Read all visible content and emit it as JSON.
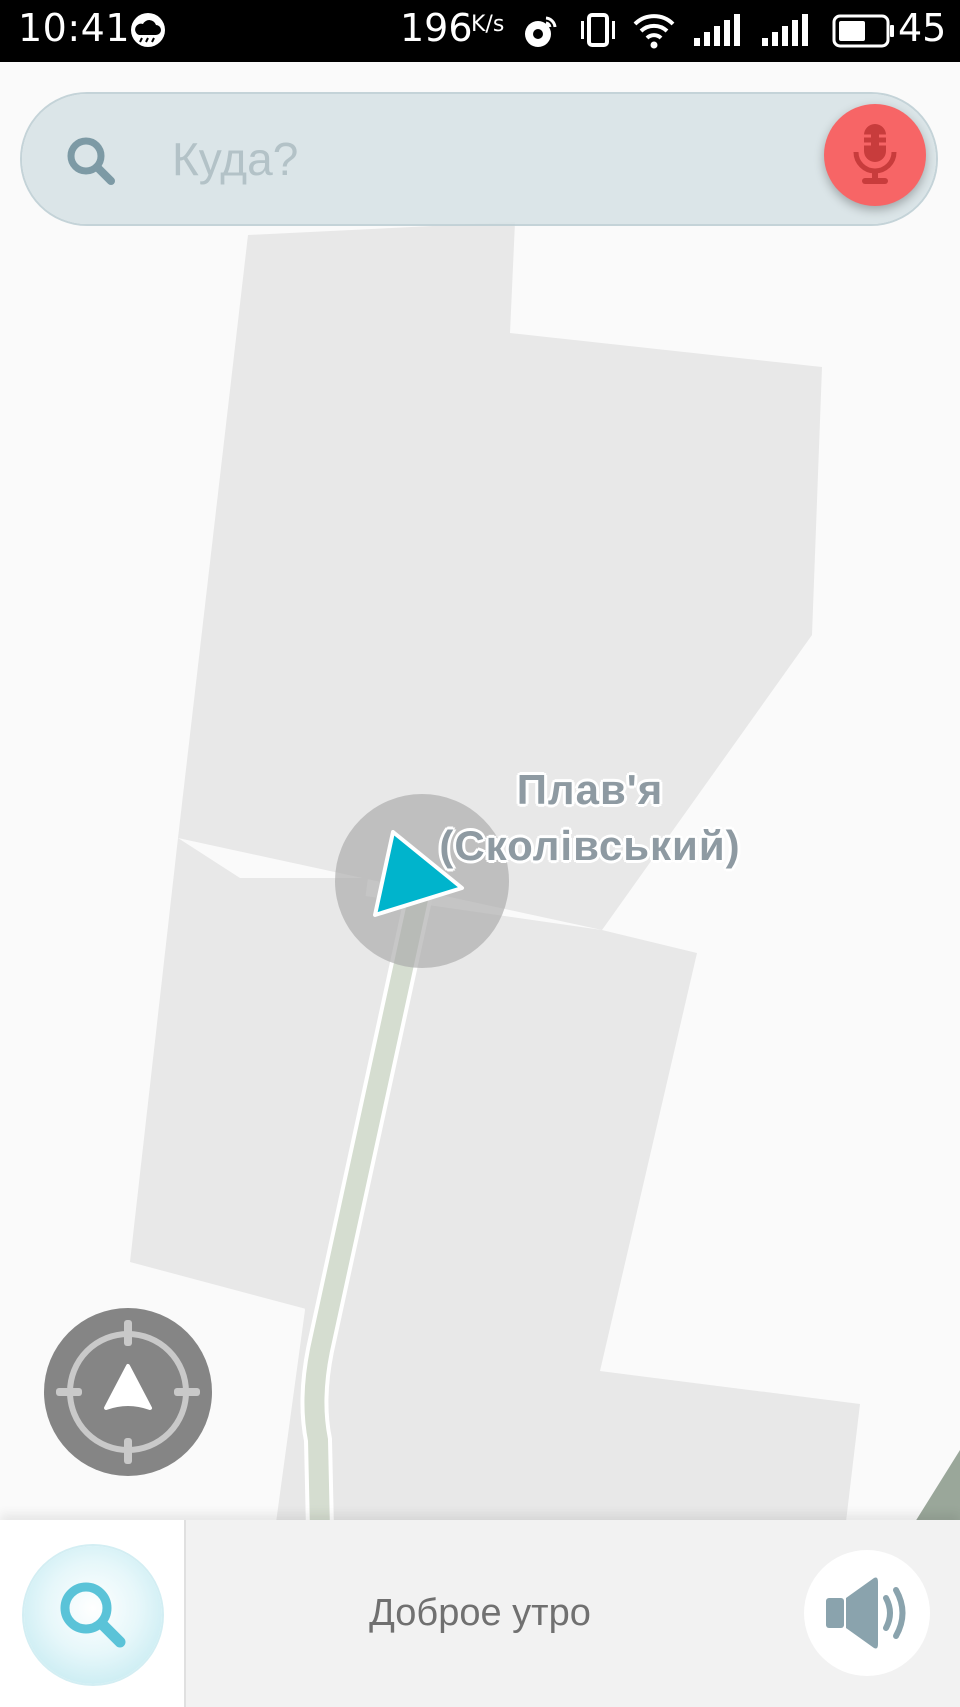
{
  "status_bar": {
    "time": "10:41",
    "network_speed": "196",
    "network_speed_unit": "K/s",
    "battery_level": "45",
    "icons": [
      "weather-cloud-icon",
      "location-sync-icon",
      "vibrate-icon",
      "wifi-icon",
      "signal-icon",
      "signal-icon",
      "battery-icon"
    ]
  },
  "search": {
    "placeholder": "Куда?",
    "icon": "search-icon",
    "voice_icon": "microphone-icon"
  },
  "map": {
    "place_label_line1": "Плав'я",
    "place_label_line2": "(Сколівський)",
    "position_marker_icon": "navigation-arrow-icon",
    "colors": {
      "background": "#fafafa",
      "area": "#e8e8e8",
      "road": "#d5ddd0",
      "marker": "#00b4cc",
      "marker_halo": "#a9a9a9"
    }
  },
  "controls": {
    "recenter_icon": "compass-target-icon"
  },
  "bottom_bar": {
    "search_icon": "search-icon",
    "greeting": "Доброе утро",
    "sound_icon": "speaker-icon",
    "accent_color": "#5ac3d8"
  }
}
